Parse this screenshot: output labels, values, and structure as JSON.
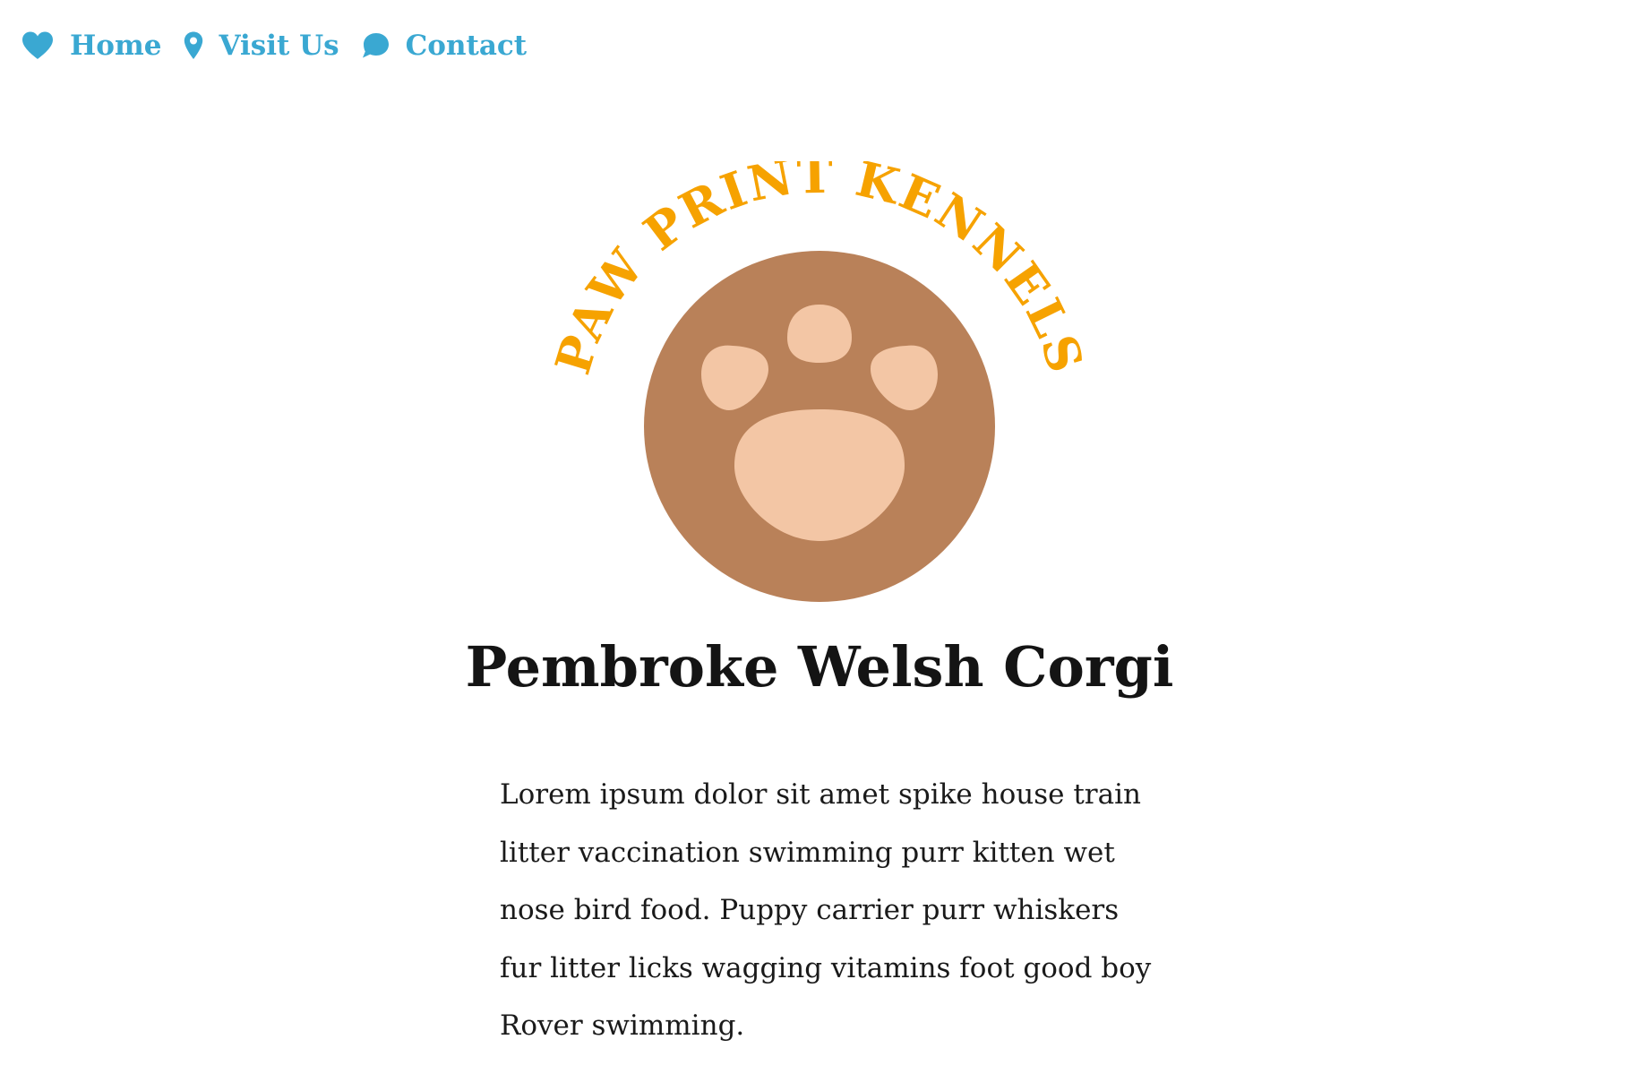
{
  "nav": {
    "items": [
      {
        "label": "Home",
        "icon": "heart-icon"
      },
      {
        "label": "Visit Us",
        "icon": "map-pin-icon"
      },
      {
        "label": "Contact",
        "icon": "speech-bubble-icon"
      }
    ]
  },
  "logo": {
    "text": "PAW PRINT KENNELS"
  },
  "main": {
    "title": "Pembroke Welsh Corgi",
    "body": "Lorem ipsum dolor sit amet spike house train litter vaccination swimming purr kitten wet nose bird food. Puppy carrier purr whiskers fur litter licks wagging vitamins foot good boy Rover swimming."
  },
  "colors": {
    "nav_link": "#3aa8d2",
    "logo_text": "#f6a200",
    "paw_circle": "#b98159",
    "paw_pads": "#f3c6a5",
    "heading": "#141414",
    "body_text": "#1a1a1a"
  }
}
